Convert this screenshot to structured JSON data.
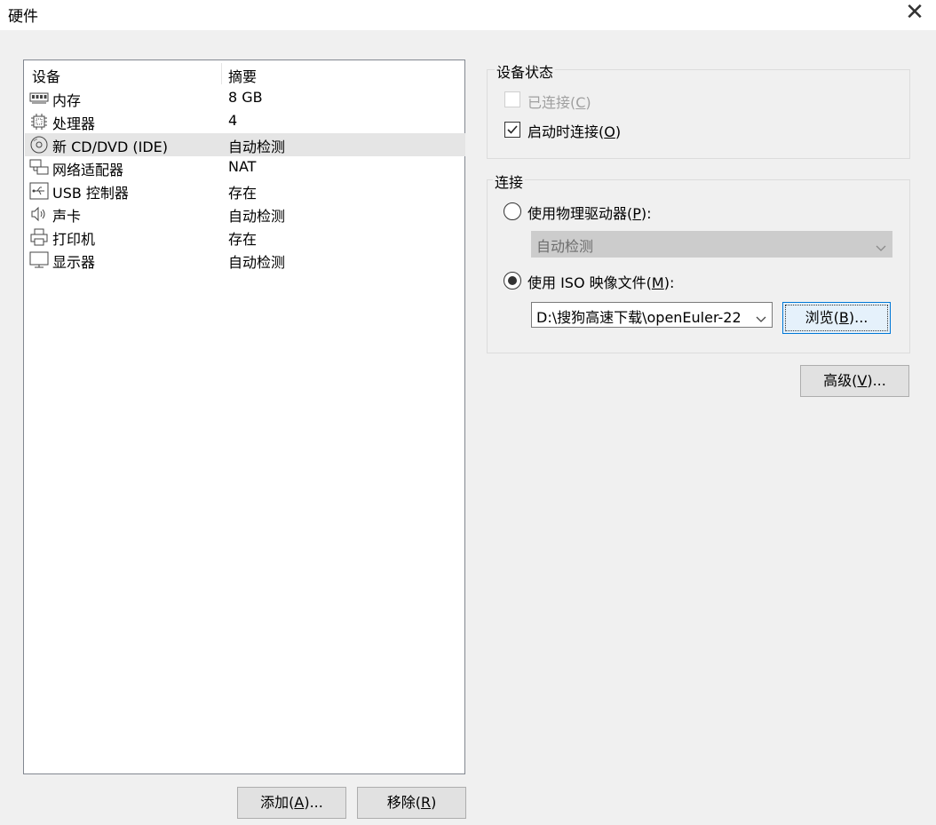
{
  "window": {
    "title": "硬件",
    "close_glyph": "✕"
  },
  "device_list": {
    "columns": [
      "设备",
      "摘要"
    ],
    "rows": [
      {
        "icon": "memory-icon",
        "name": "内存",
        "summary": "8 GB"
      },
      {
        "icon": "processor-icon",
        "name": "处理器",
        "summary": "4"
      },
      {
        "icon": "cd-dvd-icon",
        "name": "新 CD/DVD (IDE)",
        "summary": "自动检测",
        "selected": true
      },
      {
        "icon": "network-adapter-icon",
        "name": "网络适配器",
        "summary": "NAT"
      },
      {
        "icon": "usb-icon",
        "name": "USB 控制器",
        "summary": "存在"
      },
      {
        "icon": "sound-card-icon",
        "name": "声卡",
        "summary": "自动检测"
      },
      {
        "icon": "printer-icon",
        "name": "打印机",
        "summary": "存在"
      },
      {
        "icon": "display-icon",
        "name": "显示器",
        "summary": "自动检测"
      }
    ]
  },
  "buttons": {
    "add": {
      "text": "添加(",
      "key": "A",
      "tail": ")..."
    },
    "remove": {
      "text": "移除(",
      "key": "R",
      "tail": ")"
    }
  },
  "device_status": {
    "title": "设备状态",
    "connected": {
      "text": "已连接(",
      "key": "C",
      "tail": ")",
      "checked": false,
      "disabled": true
    },
    "connect_at_power_on": {
      "text": "启动时连接(",
      "key": "O",
      "tail": ")",
      "checked": true
    }
  },
  "connection": {
    "title": "连接",
    "physical": {
      "text": "使用物理驱动器(",
      "key": "P",
      "tail": "):",
      "selected": false
    },
    "physical_value": "自动检测",
    "iso": {
      "text": "使用 ISO 映像文件(",
      "key": "M",
      "tail": "):",
      "selected": true
    },
    "iso_path": "D:\\搜狗高速下载\\openEuler-22",
    "browse": {
      "text": "浏览(",
      "key": "B",
      "tail": ")..."
    }
  },
  "advanced": {
    "text": "高级(",
    "key": "V",
    "tail": ")..."
  }
}
